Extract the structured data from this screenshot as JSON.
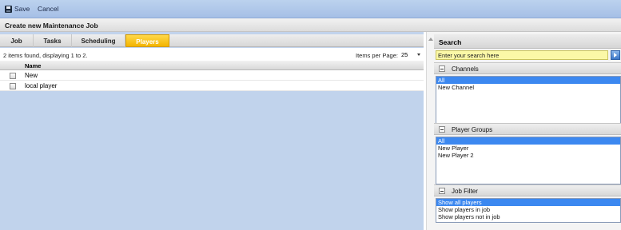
{
  "toolbar": {
    "save_label": "Save",
    "cancel_label": "Cancel"
  },
  "title": "Create new Maintenance Job",
  "tabs": [
    "Job",
    "Tasks",
    "Scheduling",
    "Players"
  ],
  "active_tab": "Players",
  "items_info": "2 items found, displaying 1 to 2.",
  "per_page": {
    "label": "Items per Page:",
    "value": "25"
  },
  "grid": {
    "column_name": "Name",
    "rows": [
      {
        "name": "New",
        "checked": false
      },
      {
        "name": "local player",
        "checked": false
      }
    ]
  },
  "search": {
    "header": "Search",
    "placeholder": "Enter your search here"
  },
  "channels": {
    "header": "Channels",
    "options": [
      "All",
      "New Channel"
    ],
    "selected": "All"
  },
  "player_groups": {
    "header": "Player Groups",
    "options": [
      "All",
      "New Player",
      "New Player 2"
    ],
    "selected": "All"
  },
  "job_filter": {
    "header": "Job Filter",
    "options": [
      "Show all players",
      "Show players in job",
      "Show players not in job"
    ],
    "selected": "Show all players"
  },
  "colors": {
    "toolbar": "#a5bfe6",
    "active_tab": "#f3b400",
    "content_bg": "#c1d3ec",
    "search_field": "#fbf8a7",
    "selection": "#3c88f0"
  },
  "icons": [
    "save-icon",
    "dropdown-arrow-icon",
    "search-go-icon",
    "collapse-icon",
    "scroll-up-icon"
  ]
}
